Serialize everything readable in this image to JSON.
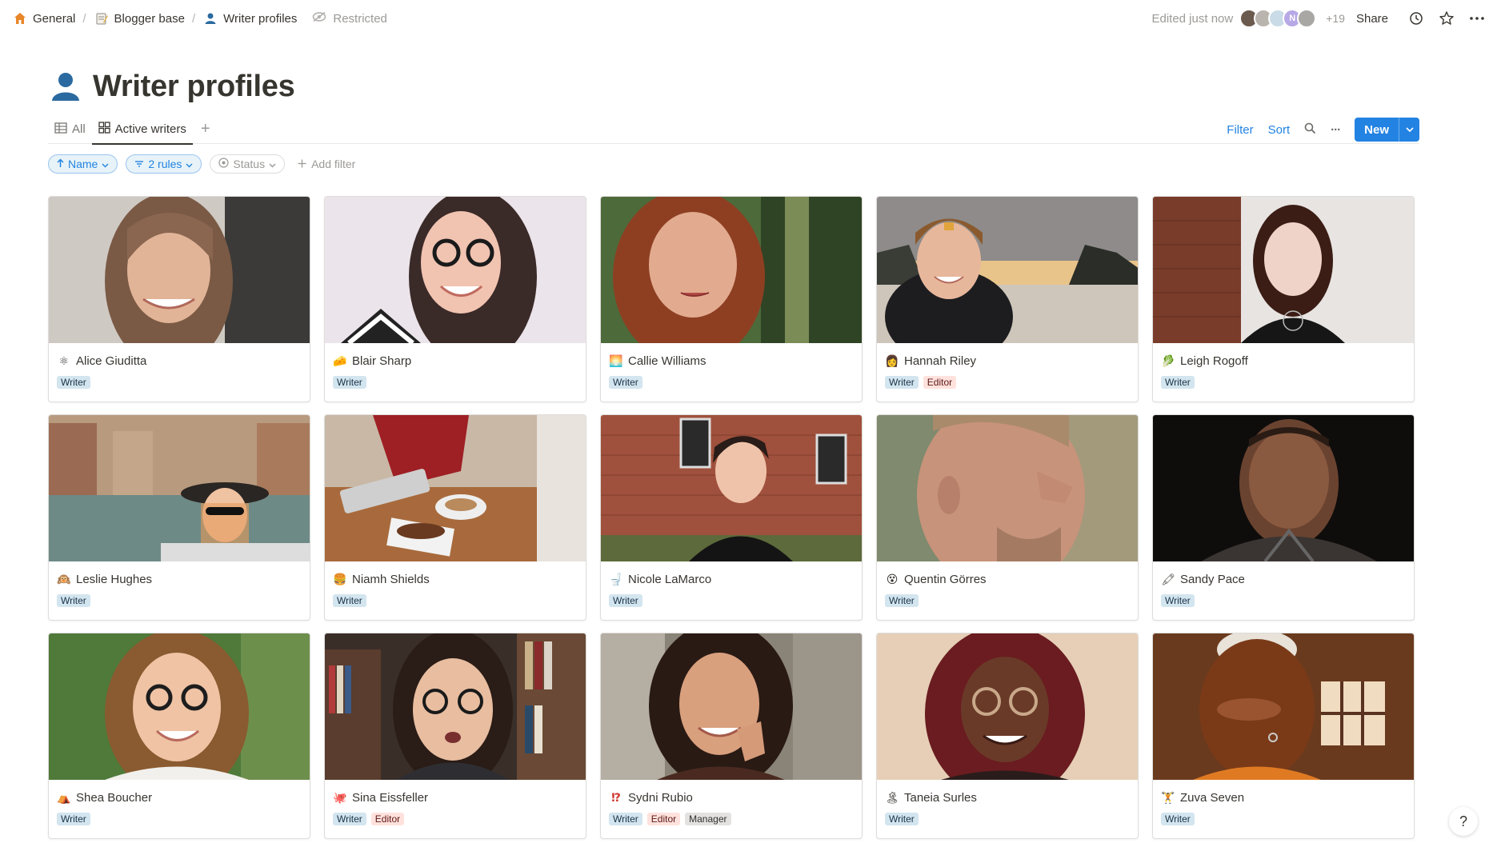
{
  "breadcrumb": [
    {
      "label": "General",
      "icon": "house-icon",
      "color": "#e8862a"
    },
    {
      "label": "Blogger base",
      "icon": "memo-icon"
    },
    {
      "label": "Writer profiles",
      "icon": "person-icon"
    }
  ],
  "restricted_label": "Restricted",
  "header": {
    "edited": "Edited just now",
    "extra_collaborators": "+19",
    "avatar_letter": "N",
    "share_label": "Share"
  },
  "page": {
    "title": "Writer profiles"
  },
  "views": {
    "tabs": [
      {
        "label": "All",
        "icon": "table-icon",
        "active": false
      },
      {
        "label": "Active writers",
        "icon": "gallery-icon",
        "active": true
      }
    ],
    "add_symbol": "+",
    "filter_label": "Filter",
    "sort_label": "Sort",
    "more_symbol": "···",
    "new_label": "New"
  },
  "filters": {
    "sort_pill": "Name",
    "rules_pill": "2 rules",
    "status_pill": "Status",
    "add_filter": "Add filter"
  },
  "colors": {
    "accent": "#2383e2",
    "writer_tag": "#d3e5ef",
    "editor_tag": "#ffe2dd",
    "manager_tag": "#e3e2e0"
  },
  "cards": [
    {
      "name": "Alice Giuditta",
      "emoji": "⚛",
      "tags": [
        "Writer"
      ]
    },
    {
      "name": "Blair Sharp",
      "emoji": "🧀",
      "tags": [
        "Writer"
      ]
    },
    {
      "name": "Callie Williams",
      "emoji": "🌅",
      "tags": [
        "Writer"
      ]
    },
    {
      "name": "Hannah Riley",
      "emoji": "👩",
      "tags": [
        "Writer",
        "Editor"
      ]
    },
    {
      "name": "Leigh Rogoff",
      "emoji": "🥬",
      "tags": [
        "Writer"
      ]
    },
    {
      "name": "Leslie Hughes",
      "emoji": "🙉",
      "tags": [
        "Writer"
      ]
    },
    {
      "name": "Niamh Shields",
      "emoji": "🍔",
      "tags": [
        "Writer"
      ]
    },
    {
      "name": "Nicole LaMarco",
      "emoji": "🚽",
      "tags": [
        "Writer"
      ]
    },
    {
      "name": "Quentin  Görres",
      "emoji": "😵",
      "tags": [
        "Writer"
      ]
    },
    {
      "name": "Sandy Pace",
      "emoji": "🖍",
      "tags": [
        "Writer"
      ]
    },
    {
      "name": "Shea Boucher",
      "emoji": "⛺",
      "tags": [
        "Writer"
      ]
    },
    {
      "name": "Sina Eissfeller",
      "emoji": "🐙",
      "tags": [
        "Writer",
        "Editor"
      ]
    },
    {
      "name": "Sydni Rubio",
      "emoji": "⁉",
      "tags": [
        "Writer",
        "Editor",
        "Manager"
      ]
    },
    {
      "name": "Taneia Surles",
      "emoji": "🏝",
      "tags": [
        "Writer"
      ]
    },
    {
      "name": "Zuva Seven",
      "emoji": "🏋",
      "tags": [
        "Writer"
      ]
    }
  ],
  "help_symbol": "?"
}
